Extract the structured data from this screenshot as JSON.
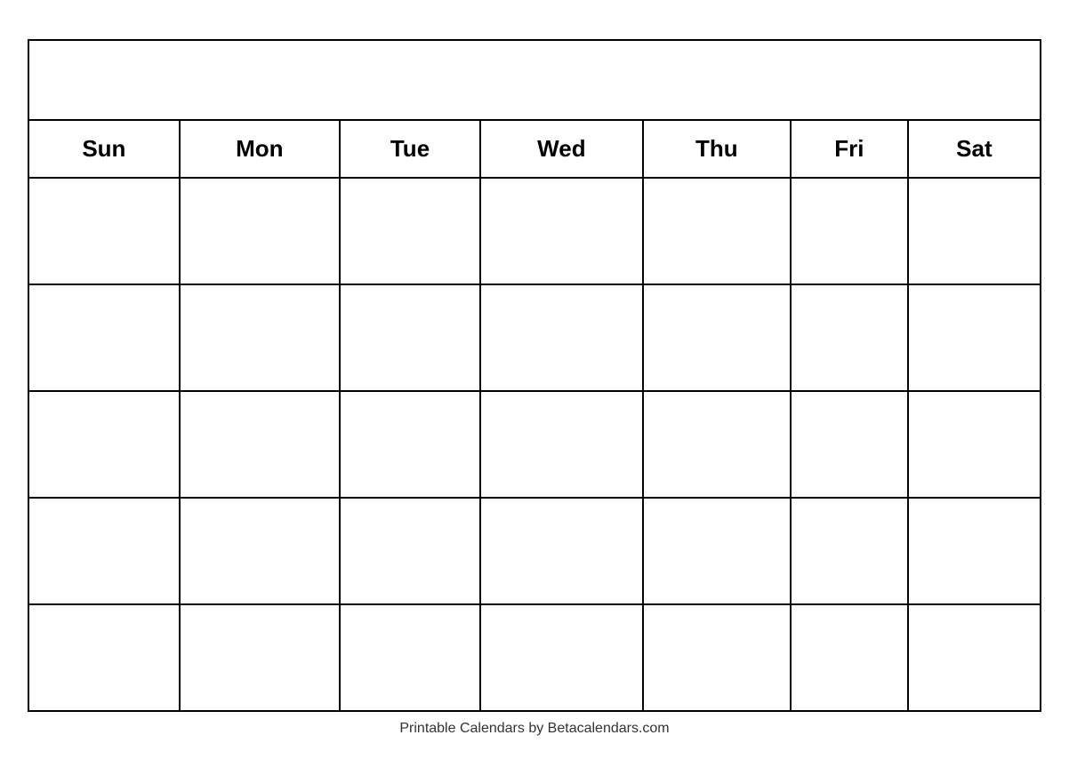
{
  "calendar": {
    "title": "",
    "days_of_week": [
      "Sun",
      "Mon",
      "Tue",
      "Wed",
      "Thu",
      "Fri",
      "Sat"
    ],
    "rows": 5,
    "footer": "Printable Calendars by Betacalendars.com"
  }
}
